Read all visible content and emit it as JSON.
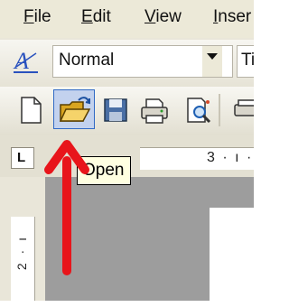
{
  "menu": {
    "items": [
      {
        "label": "File",
        "accel": "F"
      },
      {
        "label": "Edit",
        "accel": "E"
      },
      {
        "label": "View",
        "accel": "V"
      },
      {
        "label": "Inser",
        "accel": "I"
      }
    ]
  },
  "formatting": {
    "style_value": "Normal",
    "font_value": "Ti"
  },
  "toolbar": {
    "buttons": [
      "new-document-icon",
      "open-folder-icon",
      "save-disk-icon",
      "print-icon",
      "print-preview-icon",
      "spelling-icon"
    ]
  },
  "ruler": {
    "horizontal_text": "3 · ı ·",
    "vertical_text": "2 · ı"
  },
  "tooltip": {
    "text": "Open"
  },
  "colors": {
    "toolbar_bg": "#ece9d8",
    "hover_fill": "#c3d2ee",
    "hover_border": "#316ac5",
    "arrow": "#e8151b",
    "tooltip_bg": "#ffffe1"
  }
}
